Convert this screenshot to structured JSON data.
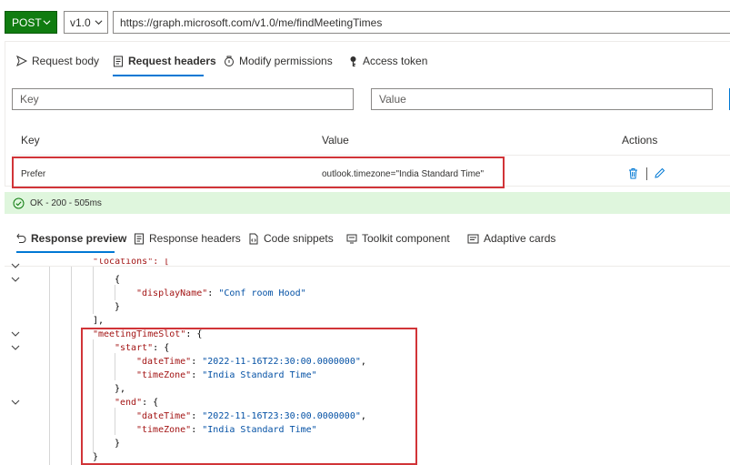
{
  "request": {
    "method": "POST",
    "version": "v1.0",
    "url": "https://graph.microsoft.com/v1.0/me/findMeetingTimes"
  },
  "request_tabs": [
    {
      "label": "Request body",
      "icon": "send-icon",
      "active": false
    },
    {
      "label": "Request headers",
      "icon": "document-icon",
      "active": true
    },
    {
      "label": "Modify permissions",
      "icon": "lock-settings-icon",
      "active": false
    },
    {
      "label": "Access token",
      "icon": "key-icon",
      "active": false
    }
  ],
  "header_inputs": {
    "key_placeholder": "Key",
    "value_placeholder": "Value"
  },
  "headers_table": {
    "columns": {
      "key": "Key",
      "value": "Value",
      "actions": "Actions"
    },
    "rows": [
      {
        "key": "Prefer",
        "value": "outlook.timezone=\"India Standard Time\""
      }
    ]
  },
  "status": {
    "text": "OK - 200 - 505ms",
    "color": "#107c10"
  },
  "response_tabs": [
    {
      "label": "Response preview",
      "icon": "undo-arrow-icon",
      "active": true
    },
    {
      "label": "Response headers",
      "icon": "document-icon",
      "active": false
    },
    {
      "label": "Code snippets",
      "icon": "code-file-icon",
      "active": false
    },
    {
      "label": "Toolkit component",
      "icon": "toolkit-icon",
      "active": false
    },
    {
      "label": "Adaptive cards",
      "icon": "card-icon",
      "active": false
    }
  ],
  "code": {
    "l1": "\"locations\": [",
    "l2": "{",
    "l3_key": "\"displayName\"",
    "l3_val": "\"Conf room Hood\"",
    "l4": "}",
    "l5": "],",
    "l6_key": "\"meetingTimeSlot\"",
    "l7_key": "\"start\"",
    "l8_key": "\"dateTime\"",
    "l8_val": "\"2022-11-16T22:30:00.0000000\"",
    "l9_key": "\"timeZone\"",
    "l9_val": "\"India Standard Time\"",
    "l10": "},",
    "l11_key": "\"end\"",
    "l12_key": "\"dateTime\"",
    "l12_val": "\"2022-11-16T23:30:00.0000000\"",
    "l13_key": "\"timeZone\"",
    "l13_val": "\"India Standard Time\"",
    "l14": "}",
    "l15": "}"
  },
  "colors": {
    "accent": "#0078d4",
    "method_green": "#107c10",
    "highlight_red": "#d13438"
  }
}
